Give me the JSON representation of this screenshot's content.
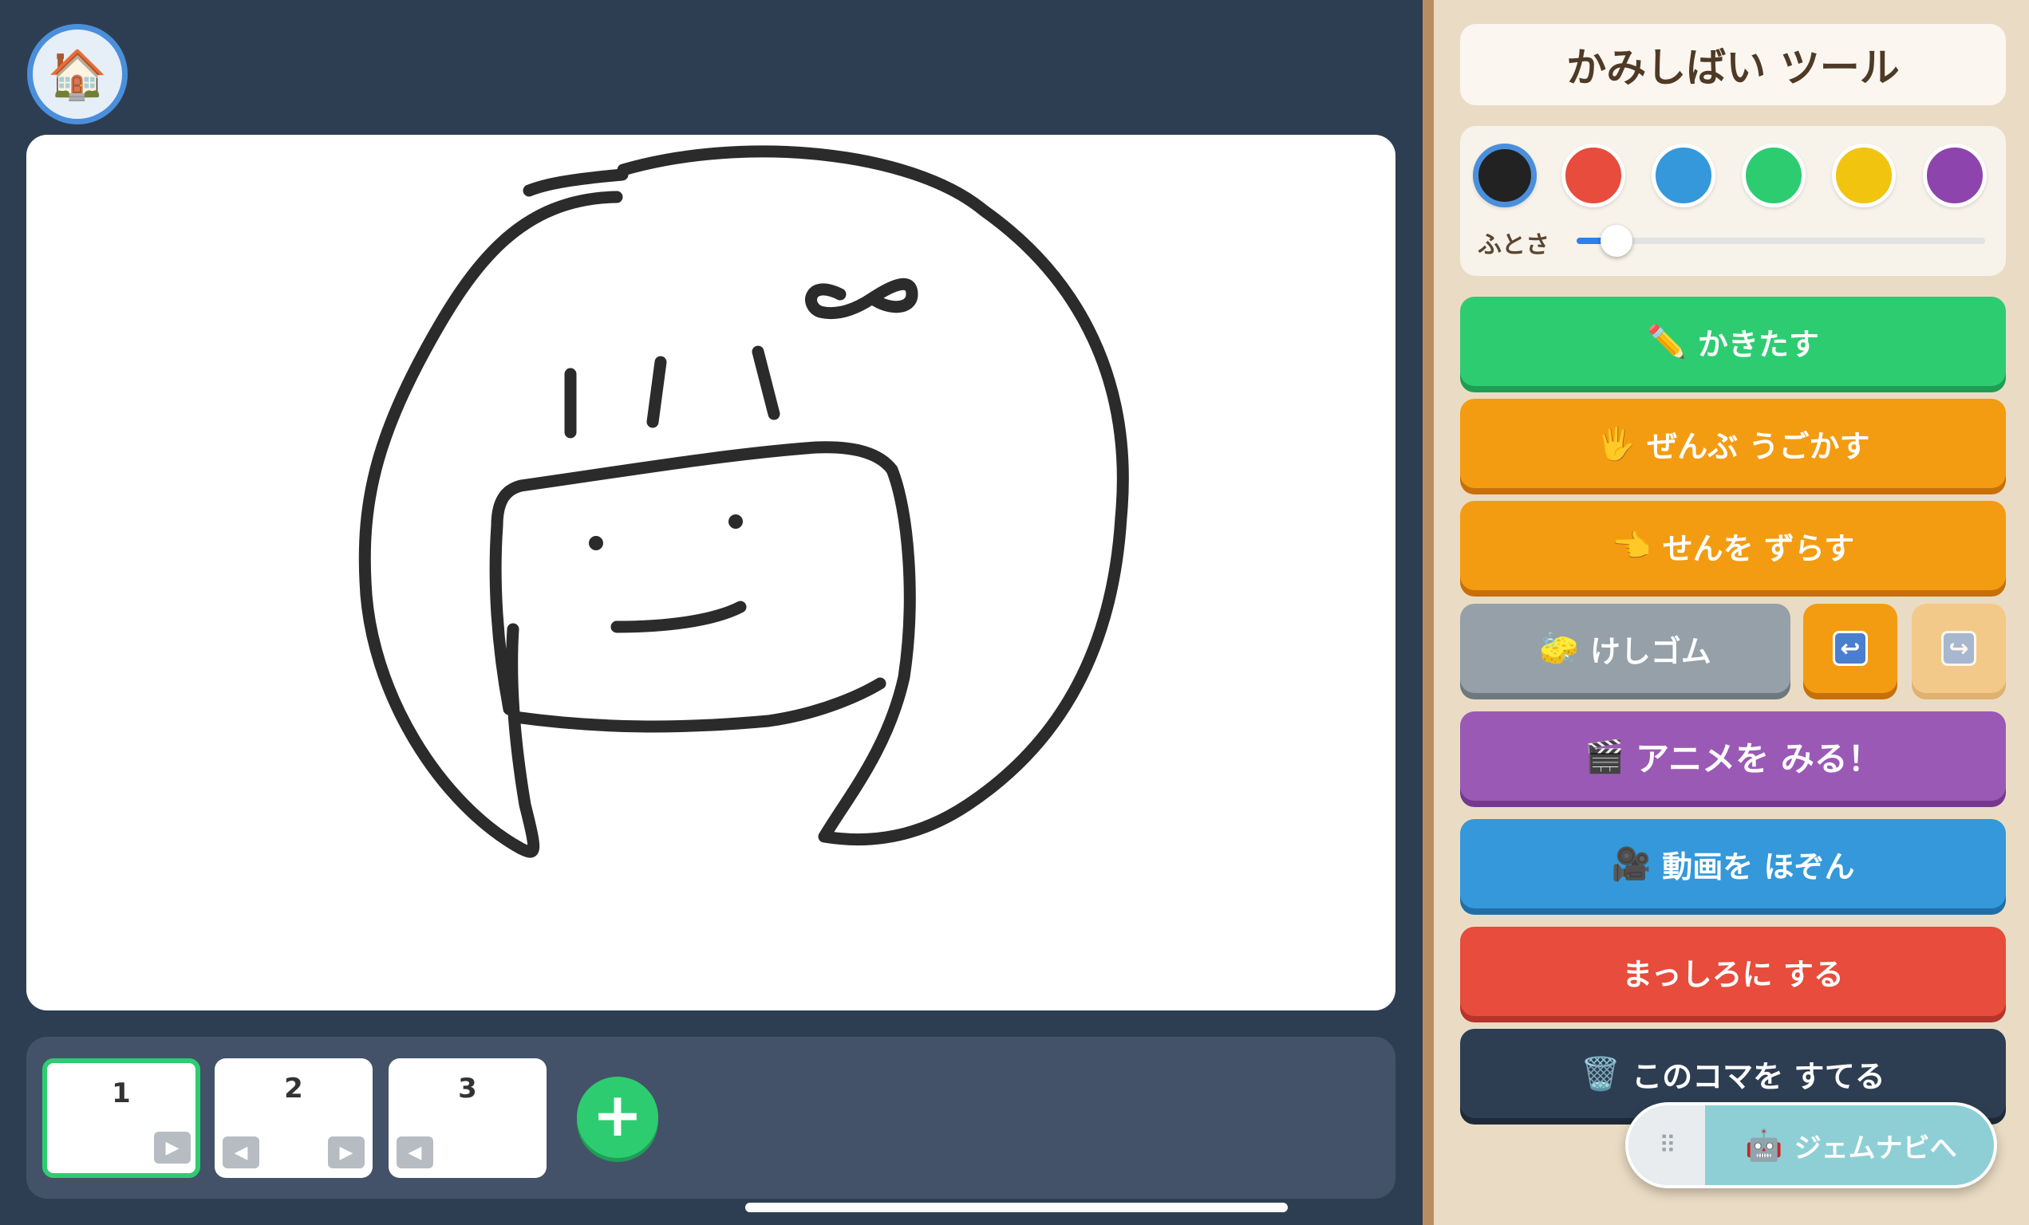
{
  "panel": {
    "title": "かみしばい ツール",
    "colors": [
      "#222222",
      "#e74c3c",
      "#3498db",
      "#2ecc71",
      "#f1c40f",
      "#8e44ad"
    ],
    "selected_color_index": 0,
    "thickness_label": "ふとさ",
    "thickness_value": 0.07
  },
  "tools": {
    "draw": {
      "icon": "✏️",
      "label": "かきたす"
    },
    "move_all": {
      "icon": "🖐",
      "label": "ぜんぶ うごかす"
    },
    "shift_line": {
      "icon": "👈",
      "label": "せんを ずらす"
    },
    "eraser": {
      "icon": "🧽",
      "label": "けしゴム"
    },
    "undo_icon": "↩",
    "redo_icon": "↪",
    "play": {
      "icon": "🎬",
      "label": "アニメを みる！"
    },
    "save": {
      "icon": "🎥",
      "label": "動画を ほぞん"
    },
    "clear": {
      "label": "まっしろに する"
    },
    "delete": {
      "icon": "🗑️",
      "label": "このコマを すてる"
    }
  },
  "frames": [
    {
      "number": "1",
      "active": true
    },
    {
      "number": "2",
      "active": false
    },
    {
      "number": "3",
      "active": false
    }
  ],
  "add_frame_label": "+",
  "home_icon": "🏠",
  "navi": {
    "grip": "⠿",
    "icon": "🤖",
    "label": "ジェムナビへ"
  }
}
